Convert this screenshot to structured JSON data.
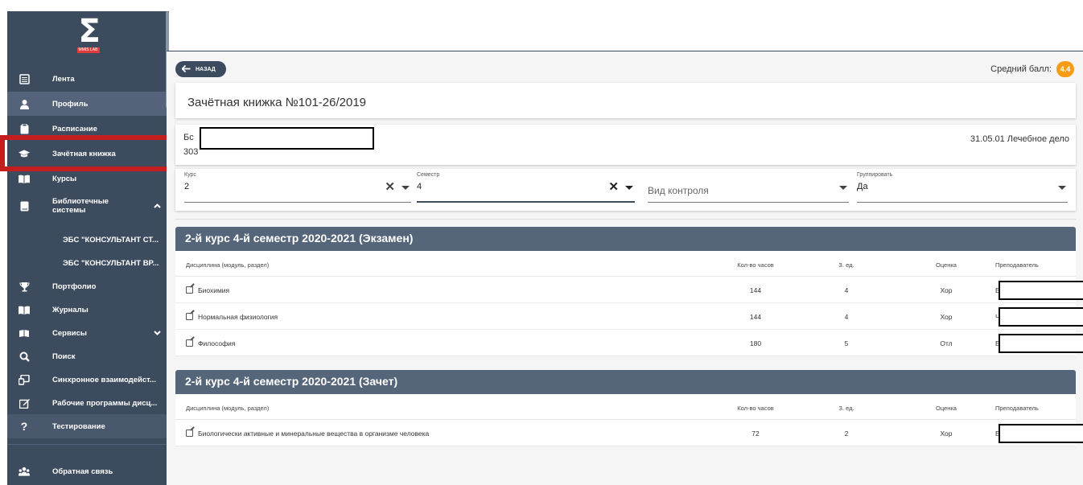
{
  "sidebar": {
    "logo": {
      "symbol": "Σ",
      "tag": "MMIS LAB"
    },
    "items": [
      {
        "label": "Лента",
        "icon": "feed-icon",
        "glyph": "▤"
      },
      {
        "label": "Профиль",
        "icon": "person-icon",
        "glyph": "●"
      },
      {
        "label": "Расписание",
        "icon": "clipboard-icon",
        "glyph": "▮"
      },
      {
        "label": "Зачётная книжка",
        "icon": "graduation-cap-icon",
        "glyph": "🎓"
      },
      {
        "label": "Курсы",
        "icon": "book-open-icon",
        "glyph": "▰"
      },
      {
        "label": "Библиотечные системы",
        "icon": "book-icon",
        "glyph": "▮"
      },
      {
        "label": "ЭБС \"КОНСУЛЬТАНТ СТ...",
        "icon": "",
        "glyph": ""
      },
      {
        "label": "ЭБС \"КОНСУЛЬТАНТ ВР...",
        "icon": "",
        "glyph": ""
      },
      {
        "label": "Портфолио",
        "icon": "trophy-icon",
        "glyph": "🏆"
      },
      {
        "label": "Журналы",
        "icon": "journal-icon",
        "glyph": "▰"
      },
      {
        "label": "Сервисы",
        "icon": "services-icon",
        "glyph": "▰"
      },
      {
        "label": "Поиск",
        "icon": "search-icon",
        "glyph": "🔍"
      },
      {
        "label": "Синхронное взаимодейст...",
        "icon": "sync-icon",
        "glyph": "⇄"
      },
      {
        "label": "Рабочие программы дисц...",
        "icon": "edit-icon",
        "glyph": "✎"
      },
      {
        "label": "Тестирование",
        "icon": "question-icon",
        "glyph": "?"
      },
      {
        "label": "Обратная связь",
        "icon": "users-icon",
        "glyph": "👥"
      }
    ]
  },
  "header": {
    "back_label": "НАЗАД",
    "avg_label": "Средний балл:",
    "avg_value": "4.4"
  },
  "record_book": {
    "title": "Зачётная книжка №101-26/2019",
    "name_prefix": "Бс",
    "group": "303",
    "specialty": "31.05.01 Лечебное дело"
  },
  "filters": {
    "course": {
      "label": "Курс",
      "value": "2"
    },
    "semester": {
      "label": "Семестр",
      "value": "4"
    },
    "control": {
      "placeholder": "Вид контроля"
    },
    "group": {
      "label": "Группировать",
      "value": "Да"
    }
  },
  "table_columns": {
    "discipline": "Дисциплина (модуль, раздел)",
    "hours": "Кол-во часов",
    "ze": "З. ед.",
    "grade": "Оценка",
    "teacher": "Преподаватель"
  },
  "sections": [
    {
      "title": "2-й курс 4-й семестр 2020-2021 (Экзамен)",
      "rows": [
        {
          "discipline": "Биохимия",
          "hours": "144",
          "ze": "4",
          "grade": "Хор",
          "teacher_initial": "Е"
        },
        {
          "discipline": "Нормальная физиология",
          "hours": "144",
          "ze": "4",
          "grade": "Хор",
          "teacher_initial": "Ч"
        },
        {
          "discipline": "Философия",
          "hours": "180",
          "ze": "5",
          "grade": "Отл",
          "teacher_initial": "Е"
        }
      ]
    },
    {
      "title": "2-й курс 4-й семестр 2020-2021 (Зачет)",
      "rows": [
        {
          "discipline": "Биологически активные и минеральные вещества в организме человека",
          "hours": "72",
          "ze": "2",
          "grade": "Хор",
          "teacher_initial": "Е"
        }
      ]
    }
  ],
  "colors": {
    "sidebar": "#3c4b5e",
    "section_header": "#55657a",
    "badge": "#f59b14",
    "highlight": "#c41e1e"
  }
}
